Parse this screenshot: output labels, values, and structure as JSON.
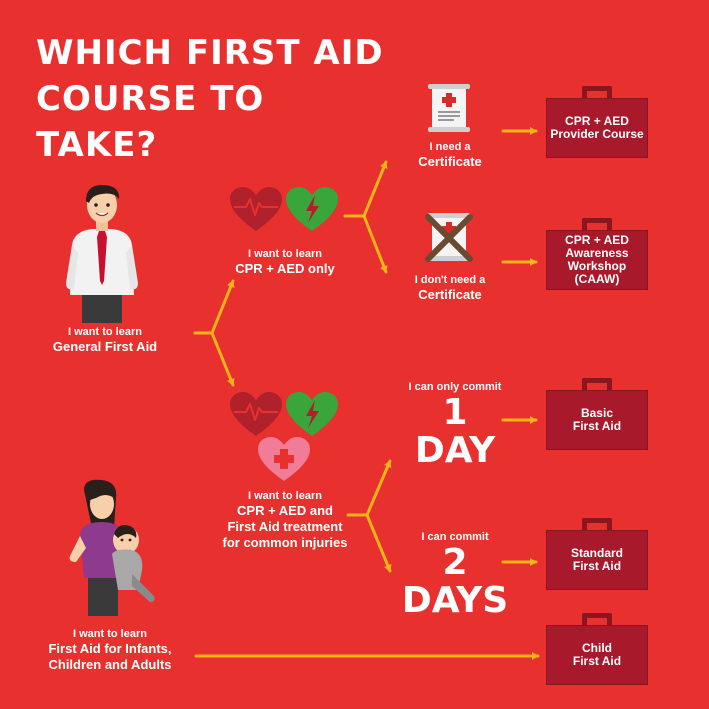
{
  "title": "WHICH FIRST AID COURSE TO TAKE?",
  "colors": {
    "background": "#e8312f",
    "case": "#a8192b",
    "arrow": "#f5b219",
    "heart_dark": "#b0212b",
    "heart_green": "#3aa53a",
    "heart_pink": "#f07c97"
  },
  "start_general": {
    "line1": "I want to learn",
    "line2": "General First Aid"
  },
  "start_infants": {
    "line1": "I want to learn",
    "line2": "First Aid for Infants,",
    "line3": "Children and Adults"
  },
  "cpr_only": {
    "line1": "I want to learn",
    "line2": "CPR + AED only"
  },
  "cpr_firstaid": {
    "line1": "I want to learn",
    "line2": "CPR + AED and",
    "line3": "First Aid treatment",
    "line4": "for common injuries"
  },
  "need_cert": {
    "line1": "I need a",
    "line2": "Certificate"
  },
  "no_cert": {
    "line1": "I don't need a",
    "line2": "Certificate"
  },
  "one_day": {
    "line1": "I can only commit",
    "number": "1",
    "unit": "DAY"
  },
  "two_days": {
    "line1": "I can commit",
    "number": "2",
    "unit": "DAYS"
  },
  "courses": [
    {
      "label": "CPR + AED\nProvider Course"
    },
    {
      "label": "CPR + AED\nAwareness\nWorkshop\n(CAAW)"
    },
    {
      "label": "Basic\nFirst Aid"
    },
    {
      "label": "Standard\nFirst Aid"
    },
    {
      "label": "Child\nFirst Aid"
    }
  ],
  "icons": [
    "man-icon",
    "woman-with-child-icon",
    "heart-rate-icon",
    "heart-bolt-icon",
    "heart-cross-icon",
    "certificate-icon",
    "crossed-certificate-icon",
    "briefcase-icon"
  ]
}
